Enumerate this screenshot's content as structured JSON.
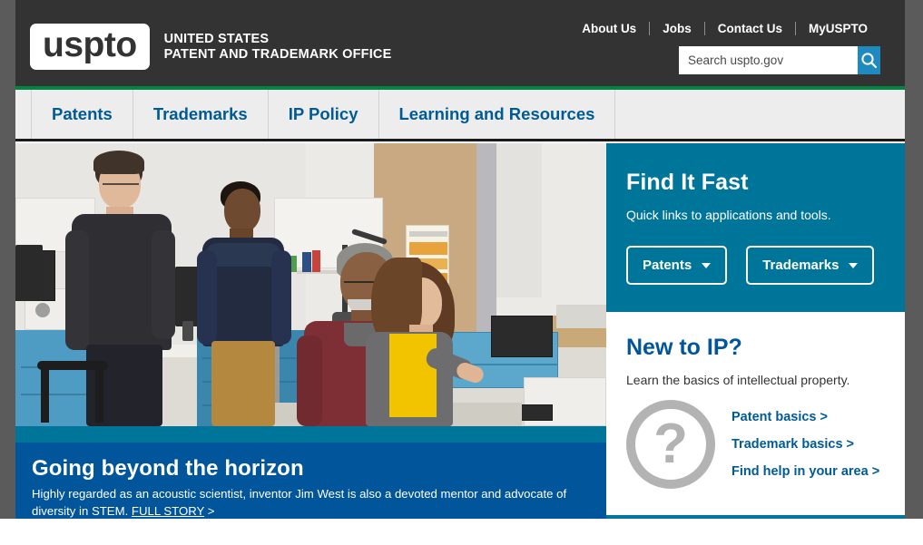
{
  "header": {
    "logo_wordmark": "uspto",
    "logo_line1": "UNITED STATES",
    "logo_line2": "PATENT AND TRADEMARK OFFICE",
    "utility_links": [
      "About Us",
      "Jobs",
      "Contact Us",
      "MyUSPTO"
    ],
    "search": {
      "placeholder": "Search uspto.gov",
      "value": "",
      "button_icon": "search-icon"
    },
    "bg_color": "#333333",
    "accent_rule_color": "#008542"
  },
  "main_nav": {
    "items": [
      "Patents",
      "Trademarks",
      "IP Policy",
      "Learning and Resources"
    ],
    "bg_color": "#ededed",
    "link_color": "#005b94"
  },
  "hero": {
    "teal_color": "#00759a",
    "caption_bg": "#00559b",
    "title": "Going beyond the horizon",
    "description_before": "Highly regarded as an acoustic scientist, inventor Jim West is also a devoted mentor and advocate of diversity in STEM. ",
    "full_story_label": "FULL STORY",
    "description_after": " >",
    "photo_alt": "Four researchers working together in a laboratory at a workbench with electronic test equipment"
  },
  "find_it_fast": {
    "title": "Find It Fast",
    "subtitle": "Quick links to applications and tools.",
    "bg_color": "#00759a",
    "buttons": [
      {
        "label": "Patents",
        "icon": "chevron-down-icon"
      },
      {
        "label": "Trademarks",
        "icon": "chevron-down-icon"
      }
    ]
  },
  "new_to_ip": {
    "title": "New to IP?",
    "subtitle": "Learn the basics of intellectual property.",
    "icon": "question-mark-circle-icon",
    "icon_glyph": "?",
    "title_color": "#00559b",
    "border_color": "#00759a",
    "links": [
      "Patent basics >",
      "Trademark basics >",
      "Find help in your area >"
    ]
  }
}
